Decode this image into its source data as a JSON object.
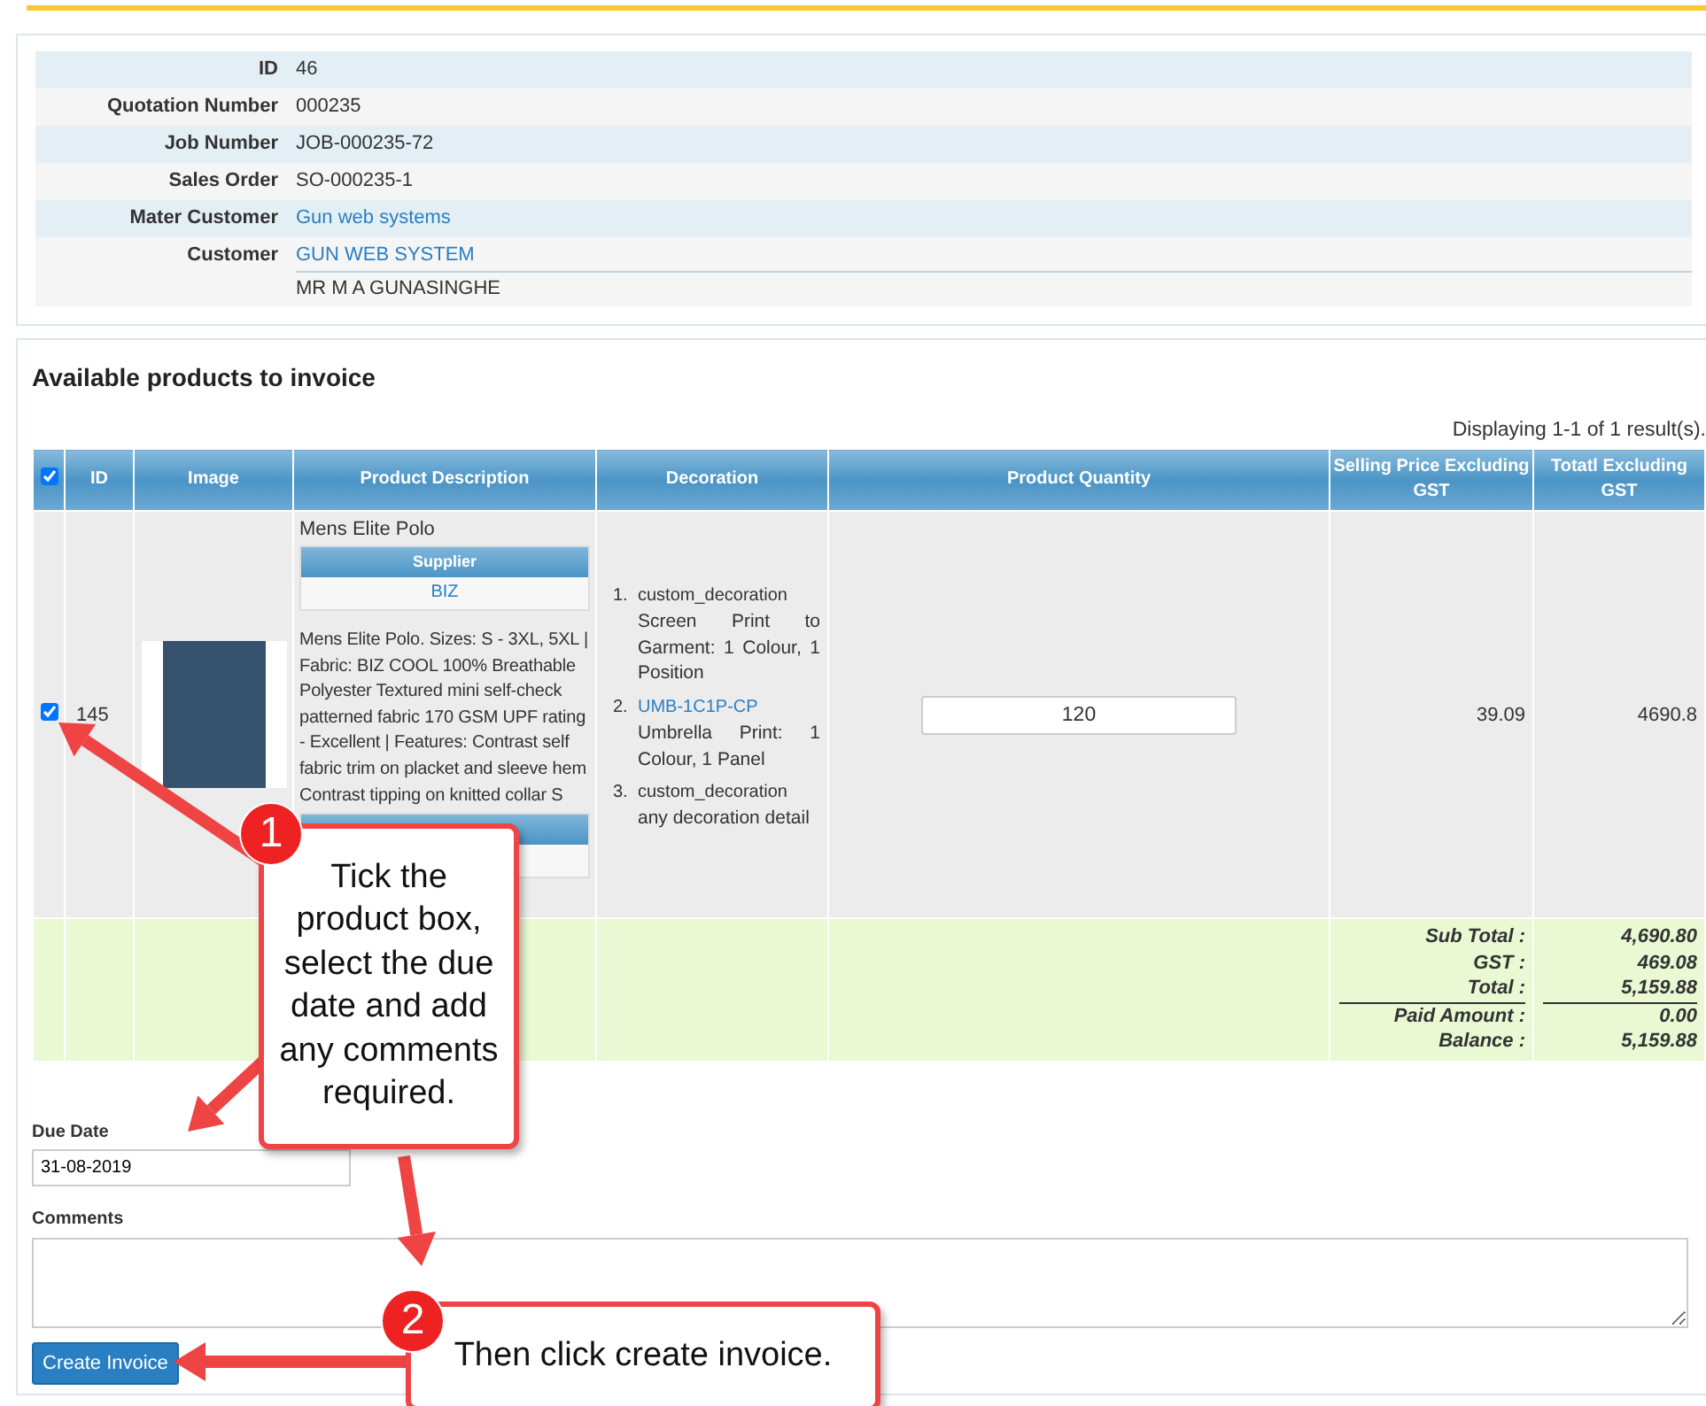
{
  "info": [
    {
      "label": "ID",
      "value": "46",
      "kind": "text"
    },
    {
      "label": "Quotation Number",
      "value": "000235",
      "kind": "text"
    },
    {
      "label": "Job Number",
      "value": "JOB-000235-72",
      "kind": "text"
    },
    {
      "label": "Sales Order",
      "value": "SO-000235-1",
      "kind": "text"
    },
    {
      "label": "Mater Customer",
      "value": "Gun web systems",
      "kind": "link"
    },
    {
      "label": "Customer",
      "value": "GUN WEB SYSTEM",
      "kind": "link",
      "subvalue": "MR M A GUNASINGHE"
    }
  ],
  "products": {
    "title": "Available products to invoice",
    "summary": "Displaying 1-1 of 1 result(s).",
    "select_all_checked": true,
    "columns": [
      "ID",
      "Image",
      "Product Description",
      "Decoration",
      "Product Quantity",
      "Selling Price Excluding GST",
      "Totatl Excluding GST"
    ],
    "rows": [
      {
        "checked": true,
        "id": "145",
        "name": "Mens Elite Polo",
        "supplier_header": "Supplier",
        "supplier": "BIZ",
        "description": "Mens Elite Polo. Sizes: S - 3XL, 5XL | Fabric: BIZ COOL 100% Breathable Polyester Textured mini self-check patterned fabric 170 GSM UPF rating - Excellent | Features: Contrast self fabric trim on placket and sleeve hem Contrast tipping on knitted collar S",
        "decorations": [
          {
            "number": "1.",
            "kind": "text",
            "code": "custom_decoration",
            "detail": "Screen Print to Garment: 1 Colour, 1 Position"
          },
          {
            "number": "2.",
            "kind": "link",
            "code": "UMB-1C1P-CP",
            "detail": "Umbrella Print: 1 Colour, 1 Panel"
          },
          {
            "number": "3.",
            "kind": "text",
            "code": "custom_decoration",
            "detail": "any decoration detail"
          }
        ],
        "quantity": "120",
        "price": "39.09",
        "total": "4690.8"
      }
    ],
    "totals": [
      {
        "label": "Sub Total :",
        "value": "4,690.80",
        "underlined": false
      },
      {
        "label": "GST :",
        "value": "469.08",
        "underlined": false
      },
      {
        "label": "Total :",
        "value": "5,159.88",
        "underlined": true
      },
      {
        "label": "Paid Amount :",
        "value": "0.00",
        "underlined": false
      },
      {
        "label": "Balance :",
        "value": "5,159.88",
        "underlined": false
      }
    ]
  },
  "due_date": {
    "label": "Due Date",
    "value": "31-08-2019"
  },
  "comments": {
    "label": "Comments"
  },
  "create_button": "Create Invoice",
  "callouts": [
    {
      "number": "1",
      "text": "Tick the product box, select the due date and add any comments required."
    },
    {
      "number": "2",
      "text": "Then click create invoice."
    }
  ]
}
